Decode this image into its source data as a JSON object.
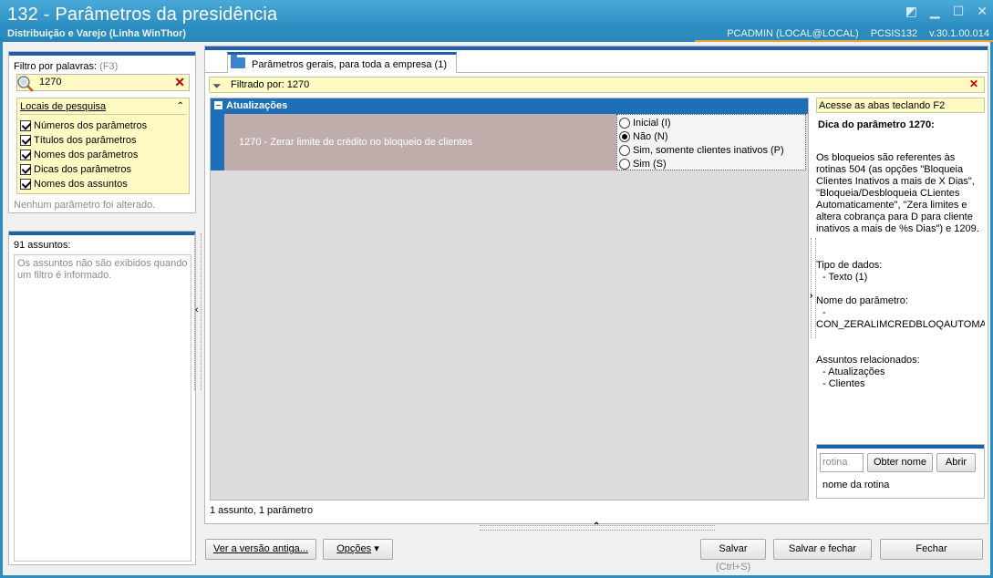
{
  "window": {
    "title": "132 - Parâmetros da presidência",
    "subtitle": "Distribuição e Varejo (Linha WinThor)",
    "user": "PCADMIN (LOCAL@LOCAL)",
    "app_code": "PCSIS132",
    "version": "v.30.1.00.014",
    "accent_color": "#e8a33a"
  },
  "filter": {
    "label": "Filtro por palavras:",
    "shortcut": "(F3)",
    "value": "1270",
    "locais_title": "Locais de pesquisa",
    "options": [
      {
        "label": "Números dos parâmetros",
        "checked": true
      },
      {
        "label": "Títulos dos parâmetros",
        "checked": true
      },
      {
        "label": "Nomes dos parâmetros",
        "checked": true
      },
      {
        "label": "Dicas dos parâmetros",
        "checked": true
      },
      {
        "label": "Nomes dos assuntos",
        "checked": true
      }
    ],
    "status": "Nenhum parâmetro foi alterado."
  },
  "subjects": {
    "count_label": "91 assuntos:",
    "message": "Os assuntos não são exibidos quando um filtro é informado."
  },
  "tab": {
    "label": "Parâmetros gerais, para toda a empresa  (1)"
  },
  "filtered_by": "Filtrado por: 1270",
  "group": {
    "title": "Atualizações",
    "param_text": "1270 - Zerar limite de crédito no bloqueio de clientes",
    "options": [
      {
        "label": "Inicial (I)",
        "selected": false
      },
      {
        "label": "Não (N)",
        "selected": true
      },
      {
        "label": "Sim, somente clientes inativos (P)",
        "selected": false
      },
      {
        "label": "Sim (S)",
        "selected": false
      }
    ]
  },
  "status_bar": "1 assunto, 1 parâmetro",
  "info": {
    "access_hint": "Acesse as abas teclando F2",
    "tip_title": "Dica do parâmetro 1270:",
    "tip_body": "Os bloqueios são referentes às rotinas 504 (as opções \"Bloqueia Clientes Inativos a mais de X Dias\", \"Bloqueia/Desbloqueia CLientes Automaticamente\", \"Zera limites e altera cobrança para D  para cliente inativos a mais de %s Dias\") e 1209.",
    "data_type_label": "Tipo de dados:",
    "data_type_value": "- Texto (1)",
    "param_name_label": "Nome do parâmetro:",
    "param_name_dash": "-",
    "param_name_value": "CON_ZERALIMCREDBLOQAUTOMATIC",
    "related_label": "Assuntos relacionados:",
    "related": [
      "- Atualizações",
      "- Clientes"
    ]
  },
  "rotina": {
    "placeholder": "rotina",
    "get_name": "Obter nome",
    "open": "Abrir",
    "name_label": "nome da rotina"
  },
  "footer": {
    "old_version": "Ver a versão antiga...",
    "options": "Opções",
    "save": "Salvar",
    "save_shortcut": "(Ctrl+S)",
    "save_close": "Salvar e fechar",
    "close": "Fechar"
  }
}
